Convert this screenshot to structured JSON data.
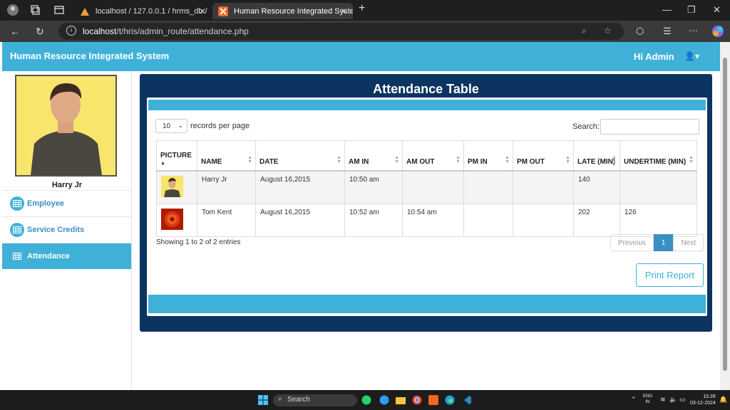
{
  "browser": {
    "tabs": [
      {
        "title": "localhost / 127.0.0.1 / hrms_db / "
      },
      {
        "title": "Human Resource Integrated Syste"
      }
    ],
    "url_host": "localhost",
    "url_path": "/t/hris/admin_route/attendance.php"
  },
  "header": {
    "brand": "Human Resource Integrated System",
    "greeting": "Hi Admin"
  },
  "sidebar": {
    "profile_name": "Harry Jr",
    "items": [
      {
        "label": "Employee"
      },
      {
        "label": "Service Credits"
      },
      {
        "label": "Attendance"
      }
    ]
  },
  "panel": {
    "title": "Attendance Table",
    "length_value": "10",
    "length_label": "records per page",
    "search_label": "Search:",
    "columns": [
      "PICTURE",
      "NAME",
      "DATE",
      "AM IN",
      "AM OUT",
      "PM IN",
      "PM OUT",
      "LATE (MIN)",
      "UNDERTIME (MIN)"
    ],
    "rows": [
      {
        "picture": "person-photo",
        "name": "Harry Jr",
        "date": "August 16,2015",
        "am_in": "10:50 am",
        "am_out": "",
        "pm_in": "",
        "pm_out": "",
        "late": "140",
        "undertime": ""
      },
      {
        "picture": "flower-photo",
        "name": "Tom Kent",
        "date": "August 16,2015",
        "am_in": "10:52 am",
        "am_out": "10:54 am",
        "pm_in": "",
        "pm_out": "",
        "late": "202",
        "undertime": "126"
      }
    ],
    "info": "Showing 1 to 2 of 2 entries",
    "pager": {
      "prev": "Previous",
      "current": "1",
      "next": "Next"
    },
    "print_label": "Print Report"
  },
  "taskbar": {
    "search": "Search",
    "lang": "ENG",
    "region": "IN",
    "time": "15:26",
    "date": "03-12-2024"
  },
  "colors": {
    "accent": "#3fb1d9",
    "panel": "#0c3461",
    "link": "#3a8fc4"
  }
}
